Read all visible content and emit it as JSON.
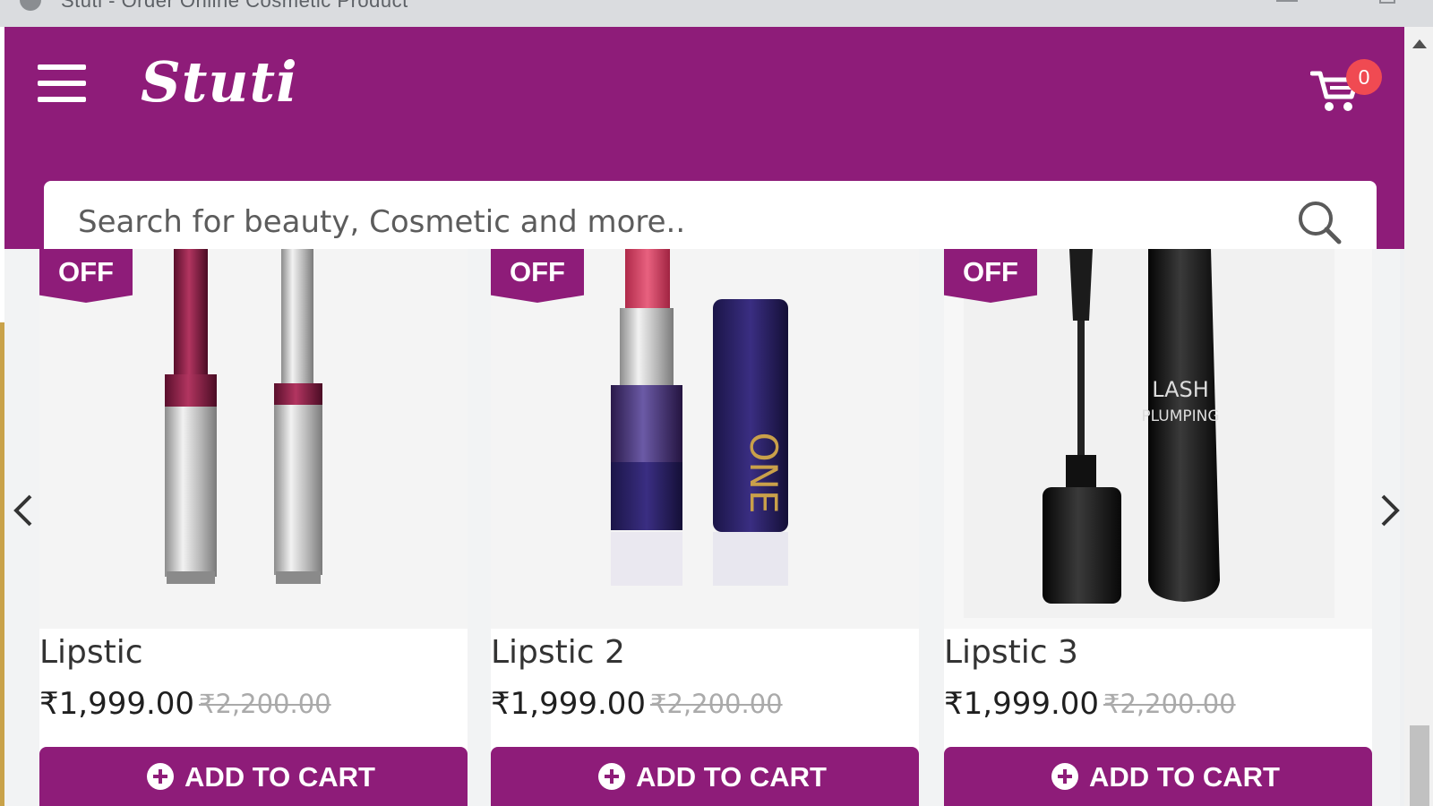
{
  "window": {
    "title": "Stuti - Order Online Cosmetic Product"
  },
  "header": {
    "logo": "Stuti",
    "cart_count": "0",
    "search_placeholder": "Search for beauty, Cosmetic and more.."
  },
  "products": [
    {
      "badge": "OFF",
      "name": "Lipstic",
      "price": "₹1,999.00",
      "old_price": "₹2,200.00",
      "button": "ADD TO CART"
    },
    {
      "badge": "OFF",
      "name": "Lipstic 2",
      "price": "₹1,999.00",
      "old_price": "₹2,200.00",
      "button": "ADD TO CART"
    },
    {
      "badge": "OFF",
      "name": "Lipstic 3",
      "price": "₹1,999.00",
      "old_price": "₹2,200.00",
      "button": "ADD TO CART"
    }
  ],
  "colors": {
    "brand": "#8e1c79",
    "badge_red": "#f04a52",
    "strike_gray": "#aaaaaa"
  },
  "icons": [
    "menu-icon",
    "cart-icon",
    "search-icon",
    "chevron-left-icon",
    "chevron-right-icon",
    "plus-circle-icon"
  ]
}
